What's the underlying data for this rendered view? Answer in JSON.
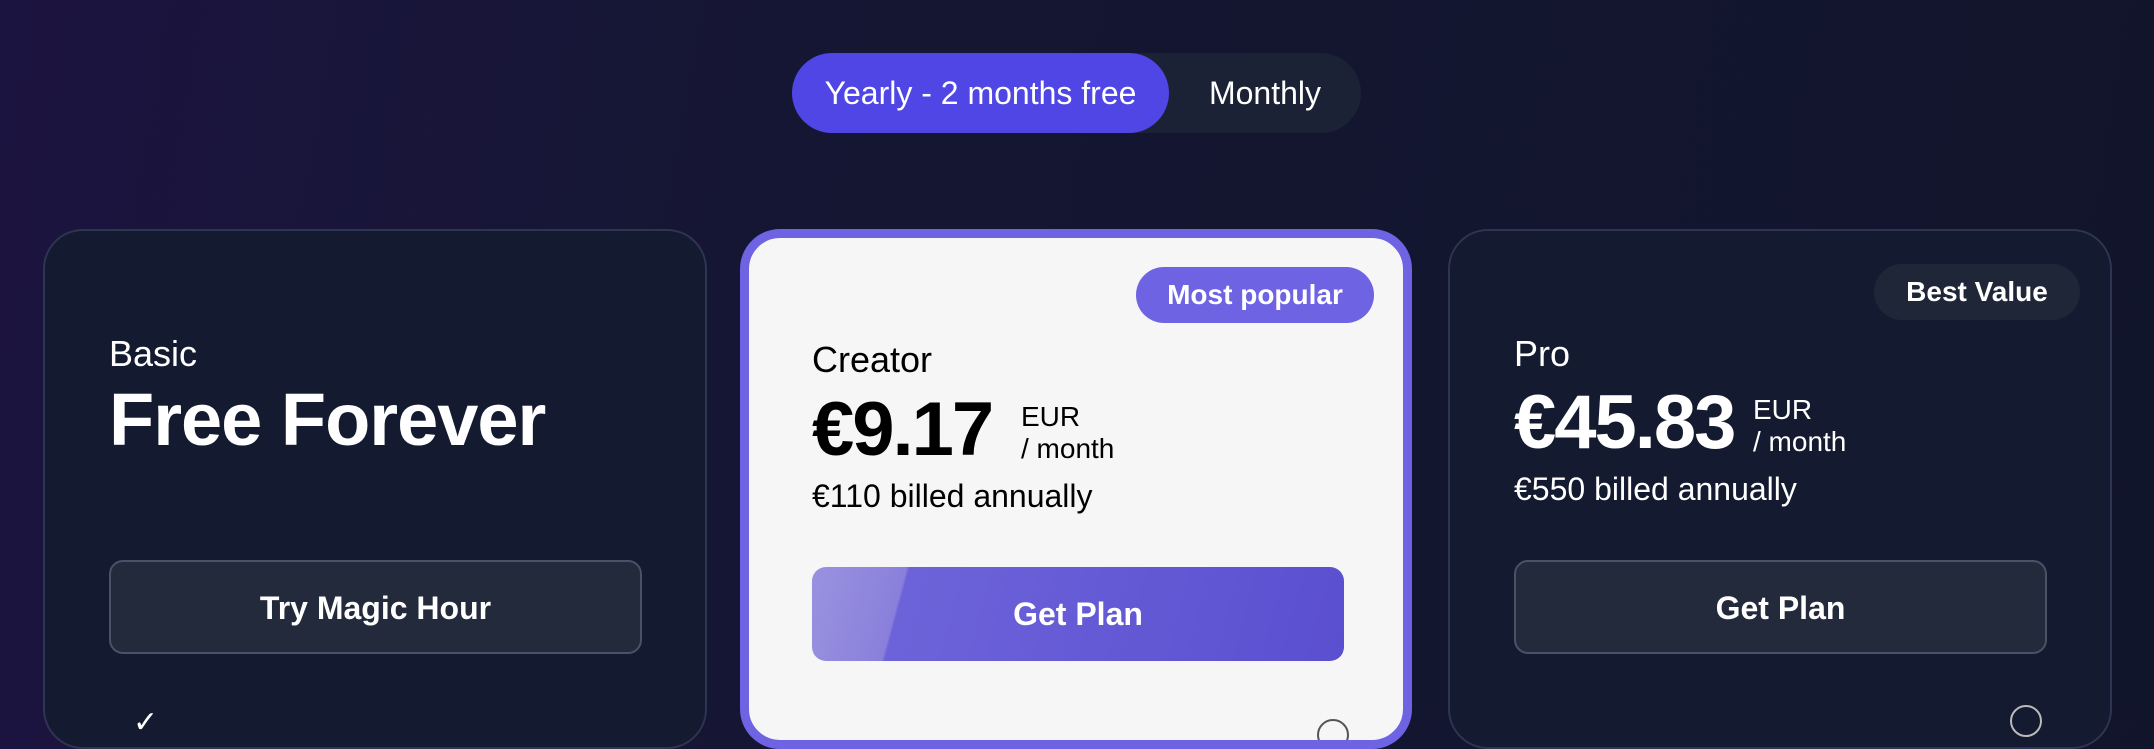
{
  "billing_toggle": {
    "yearly_label": "Yearly - 2 months free",
    "monthly_label": "Monthly",
    "selected": "yearly"
  },
  "plans": [
    {
      "name": "Basic",
      "headline": "Free Forever",
      "button_label": "Try Magic Hour"
    },
    {
      "name": "Creator",
      "badge": "Most popular",
      "price": "€9.17",
      "currency": "EUR",
      "period": "/ month",
      "billed": "€110 billed annually",
      "button_label": "Get Plan"
    },
    {
      "name": "Pro",
      "badge": "Best Value",
      "price": "€45.83",
      "currency": "EUR",
      "period": "/ month",
      "billed": "€550 billed annually",
      "button_label": "Get Plan"
    }
  ],
  "colors": {
    "accent": "#4f46e5",
    "highlight_border": "#6d63e3",
    "card_dark": "#141a2f",
    "card_light": "#f6f6f6"
  }
}
